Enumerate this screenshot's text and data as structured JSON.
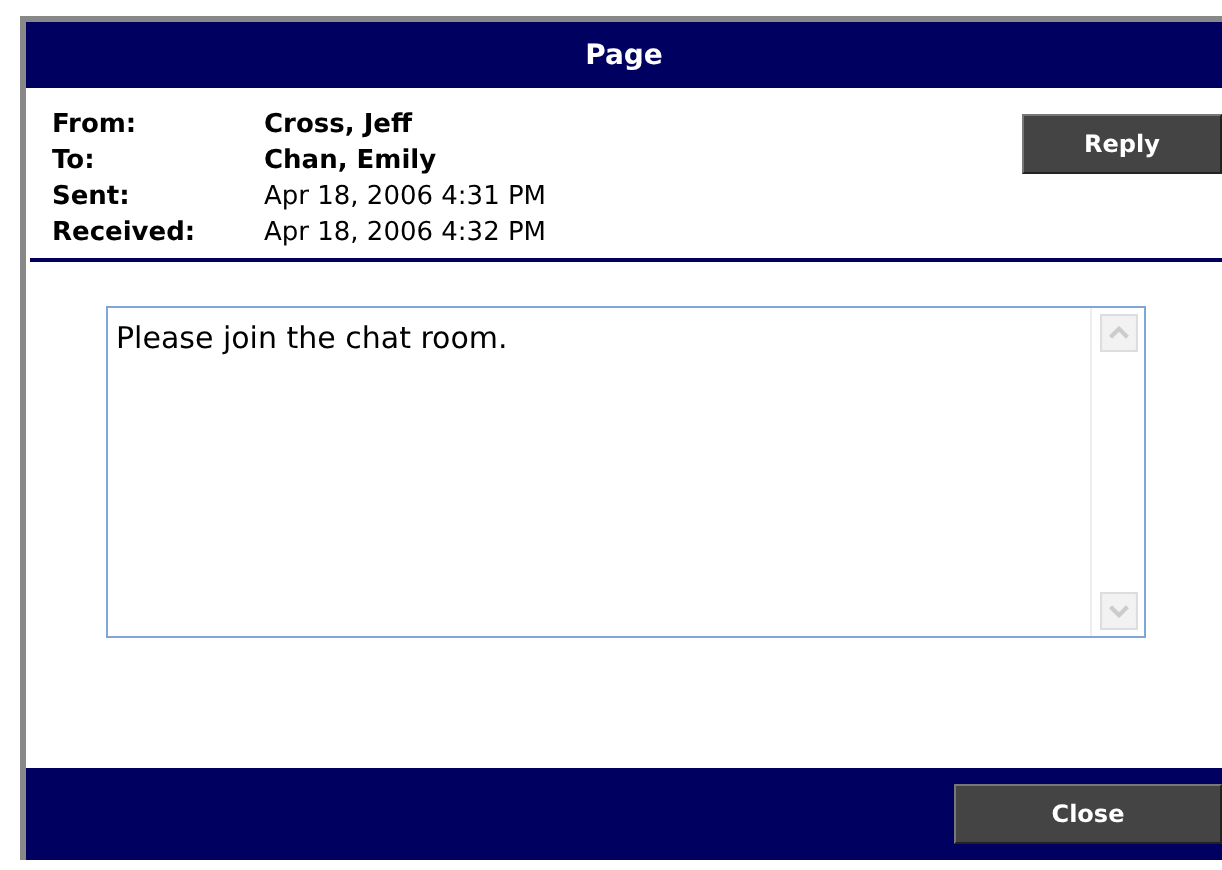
{
  "window": {
    "title": "Page"
  },
  "header_fields": [
    {
      "label": "From:",
      "value": "Cross, Jeff",
      "emphasized": true
    },
    {
      "label": "To:",
      "value": "Chan, Emily",
      "emphasized": true
    },
    {
      "label": "Sent:",
      "value": "Apr 18, 2006 4:31 PM",
      "emphasized": false
    },
    {
      "label": "Received:",
      "value": "Apr 18, 2006 4:32 PM",
      "emphasized": false
    }
  ],
  "reply_button": "Reply",
  "message": {
    "value": "Please join the chat room."
  },
  "close_button": "Close"
}
